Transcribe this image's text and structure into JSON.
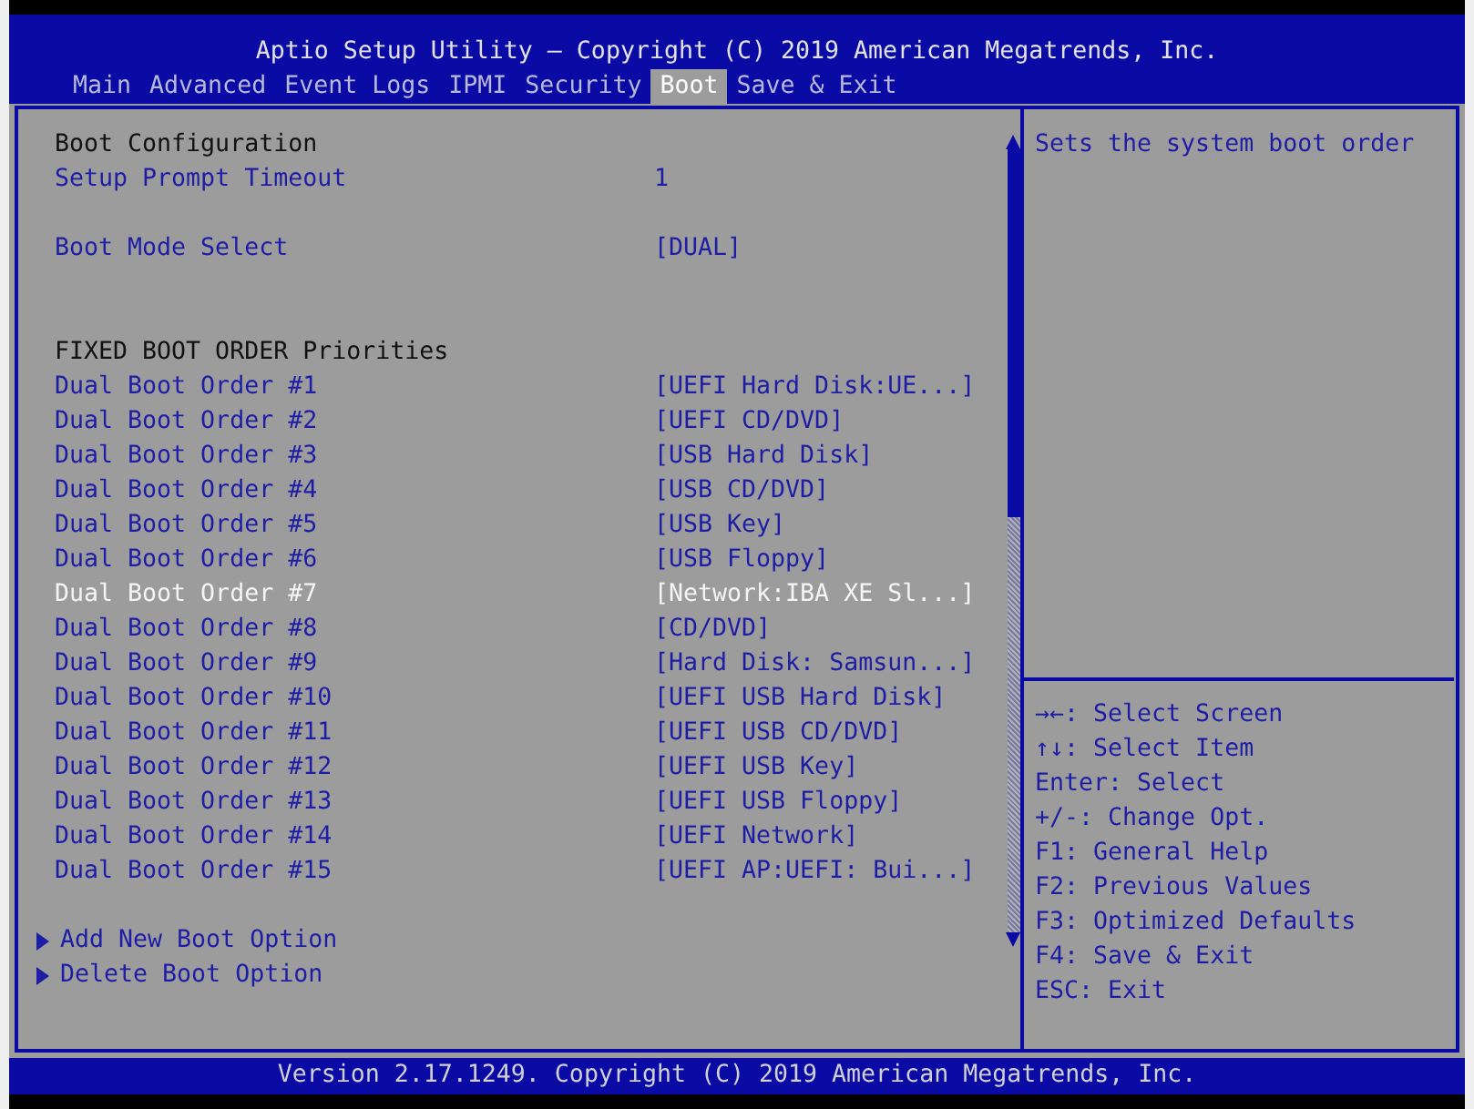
{
  "title": "Aptio Setup Utility – Copyright (C) 2019 American Megatrends, Inc.",
  "tabs": [
    {
      "label": "Main",
      "selected": false
    },
    {
      "label": "Advanced",
      "selected": false
    },
    {
      "label": "Event Logs",
      "selected": false
    },
    {
      "label": "IPMI",
      "selected": false
    },
    {
      "label": "Security",
      "selected": false
    },
    {
      "label": "Boot",
      "selected": true
    },
    {
      "label": "Save & Exit",
      "selected": false
    }
  ],
  "items": [
    {
      "kind": "heading",
      "label": "Boot Configuration"
    },
    {
      "kind": "setting",
      "label": "Setup Prompt Timeout",
      "value": "1",
      "selected": false
    },
    {
      "kind": "gap"
    },
    {
      "kind": "setting",
      "label": "Boot Mode Select",
      "value": "[DUAL]",
      "selected": false
    },
    {
      "kind": "gap"
    },
    {
      "kind": "gap"
    },
    {
      "kind": "heading",
      "label": "FIXED BOOT ORDER Priorities"
    },
    {
      "kind": "setting",
      "label": "Dual Boot Order #1",
      "value": "[UEFI Hard Disk:UE...]",
      "selected": false
    },
    {
      "kind": "setting",
      "label": "Dual Boot Order #2",
      "value": "[UEFI CD/DVD]",
      "selected": false
    },
    {
      "kind": "setting",
      "label": "Dual Boot Order #3",
      "value": "[USB Hard Disk]",
      "selected": false
    },
    {
      "kind": "setting",
      "label": "Dual Boot Order #4",
      "value": "[USB CD/DVD]",
      "selected": false
    },
    {
      "kind": "setting",
      "label": "Dual Boot Order #5",
      "value": "[USB Key]",
      "selected": false
    },
    {
      "kind": "setting",
      "label": "Dual Boot Order #6",
      "value": "[USB Floppy]",
      "selected": false
    },
    {
      "kind": "setting",
      "label": "Dual Boot Order #7",
      "value": "[Network:IBA XE Sl...]",
      "selected": true
    },
    {
      "kind": "setting",
      "label": "Dual Boot Order #8",
      "value": "[CD/DVD]",
      "selected": false
    },
    {
      "kind": "setting",
      "label": "Dual Boot Order #9",
      "value": "[Hard Disk: Samsun...]",
      "selected": false
    },
    {
      "kind": "setting",
      "label": "Dual Boot Order #10",
      "value": "[UEFI USB Hard Disk]",
      "selected": false
    },
    {
      "kind": "setting",
      "label": "Dual Boot Order #11",
      "value": "[UEFI USB CD/DVD]",
      "selected": false
    },
    {
      "kind": "setting",
      "label": "Dual Boot Order #12",
      "value": "[UEFI USB Key]",
      "selected": false
    },
    {
      "kind": "setting",
      "label": "Dual Boot Order #13",
      "value": "[UEFI USB Floppy]",
      "selected": false
    },
    {
      "kind": "setting",
      "label": "Dual Boot Order #14",
      "value": "[UEFI Network]",
      "selected": false
    },
    {
      "kind": "setting",
      "label": "Dual Boot Order #15",
      "value": "[UEFI AP:UEFI: Bui...]",
      "selected": false
    },
    {
      "kind": "gap"
    },
    {
      "kind": "submenu",
      "label": "Add New Boot Option",
      "selected": false
    },
    {
      "kind": "submenu",
      "label": "Delete Boot Option",
      "selected": false
    }
  ],
  "help": {
    "description": "Sets the system boot order",
    "keys": [
      "→←: Select Screen",
      "↑↓: Select Item",
      "Enter: Select",
      "+/-: Change Opt.",
      "F1: General Help",
      "F2: Previous Values",
      "F3: Optimized Defaults",
      "F4: Save & Exit",
      "ESC: Exit"
    ]
  },
  "footer": "Version 2.17.1249. Copyright (C) 2019 American Megatrends, Inc."
}
